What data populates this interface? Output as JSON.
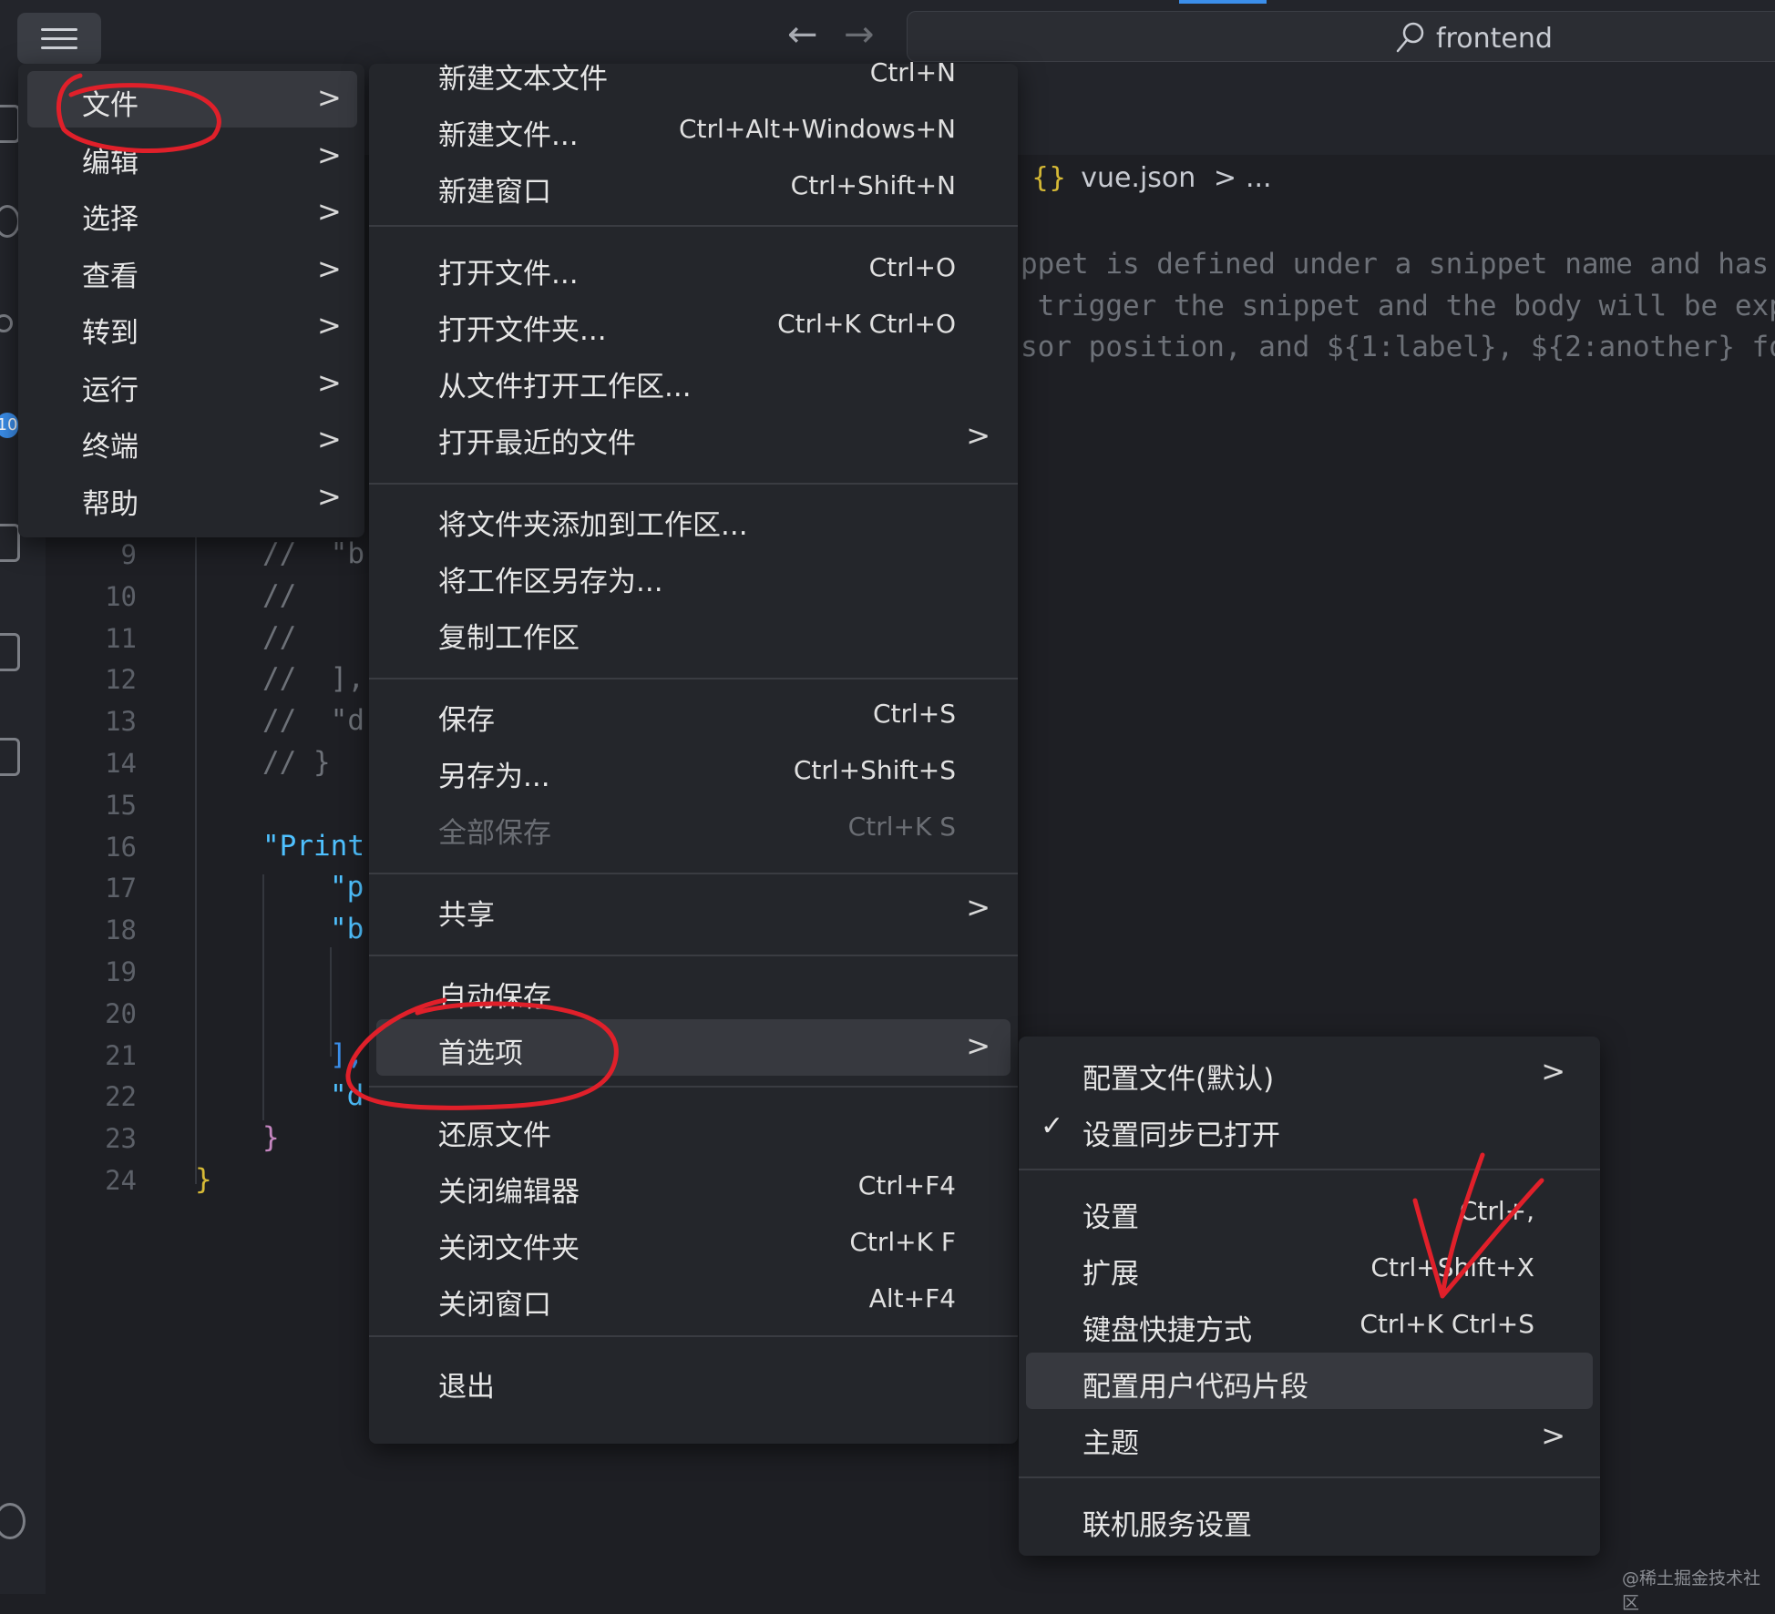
{
  "titlebar": {
    "search_text": "frontend",
    "back_glyph": "←",
    "forward_glyph": "→",
    "icons": [
      "menu-icon",
      "arrow-left-icon",
      "arrow-right-icon",
      "search-icon"
    ]
  },
  "activity_bar": {
    "badge": "10"
  },
  "breadcrumb": {
    "brace": "{}",
    "file": "vue.json",
    "sep": ">",
    "rest": "..."
  },
  "editor_comments": [
    "ppet is defined under a snippet name and has",
    " trigger the snippet and the body will be exp",
    "sor position, and ${1:label}, ${2:another} fo"
  ],
  "line_numbers": [
    "9",
    "10",
    "11",
    "12",
    "13",
    "14",
    "15",
    "16",
    "17",
    "18",
    "19",
    "20",
    "21",
    "22",
    "23",
    "24"
  ],
  "code_lines": [
    {
      "text": "//  \"b"
    },
    {
      "text": "//"
    },
    {
      "text": "//"
    },
    {
      "text": "//  ],"
    },
    {
      "text": "//  \"d"
    },
    {
      "text": "// }"
    },
    {
      "text": ""
    },
    {
      "text": "\"Print"
    },
    {
      "text": "\"p"
    },
    {
      "text": "\"b"
    },
    {
      "text": ""
    },
    {
      "text": ""
    },
    {
      "text": "],"
    },
    {
      "text": "\"d"
    },
    {
      "text": "}"
    },
    {
      "text": "}"
    }
  ],
  "main_menu": [
    {
      "label": "文件"
    },
    {
      "label": "编辑"
    },
    {
      "label": "选择"
    },
    {
      "label": "查看"
    },
    {
      "label": "转到"
    },
    {
      "label": "运行"
    },
    {
      "label": "终端"
    },
    {
      "label": "帮助"
    }
  ],
  "chevron": ">",
  "file_menu": [
    {
      "label": "新建文本文件",
      "shortcut": "Ctrl+N"
    },
    {
      "label": "新建文件...",
      "shortcut": "Ctrl+Alt+Windows+N"
    },
    {
      "label": "新建窗口",
      "shortcut": "Ctrl+Shift+N"
    },
    {
      "label": "打开文件...",
      "shortcut": "Ctrl+O"
    },
    {
      "label": "打开文件夹...",
      "shortcut": "Ctrl+K Ctrl+O"
    },
    {
      "label": "从文件打开工作区...",
      "shortcut": ""
    },
    {
      "label": "打开最近的文件",
      "shortcut": ""
    },
    {
      "label": "将文件夹添加到工作区...",
      "shortcut": ""
    },
    {
      "label": "将工作区另存为...",
      "shortcut": ""
    },
    {
      "label": "复制工作区",
      "shortcut": ""
    },
    {
      "label": "保存",
      "shortcut": "Ctrl+S"
    },
    {
      "label": "另存为...",
      "shortcut": "Ctrl+Shift+S"
    },
    {
      "label": "全部保存",
      "shortcut": "Ctrl+K S"
    },
    {
      "label": "共享",
      "shortcut": ""
    },
    {
      "label": "自动保存",
      "shortcut": ""
    },
    {
      "label": "首选项",
      "shortcut": ""
    },
    {
      "label": "还原文件",
      "shortcut": ""
    },
    {
      "label": "关闭编辑器",
      "shortcut": "Ctrl+F4"
    },
    {
      "label": "关闭文件夹",
      "shortcut": "Ctrl+K F"
    },
    {
      "label": "关闭窗口",
      "shortcut": "Alt+F4"
    },
    {
      "label": "退出",
      "shortcut": ""
    }
  ],
  "prefs_menu": [
    {
      "label": "配置文件(默认)",
      "shortcut": ""
    },
    {
      "label": "设置同步已打开",
      "shortcut": "",
      "check": "✓"
    },
    {
      "label": "设置",
      "shortcut": "Ctrl+,"
    },
    {
      "label": "扩展",
      "shortcut": "Ctrl+Shift+X"
    },
    {
      "label": "键盘快捷方式",
      "shortcut": "Ctrl+K Ctrl+S"
    },
    {
      "label": "配置用户代码片段",
      "shortcut": ""
    },
    {
      "label": "主题",
      "shortcut": ""
    },
    {
      "label": "联机服务设置",
      "shortcut": ""
    }
  ],
  "colors": {
    "accent": "#3b8eea",
    "annotation": "#e0202a",
    "menu_bg": "#24262b",
    "highlight": "#37393f"
  },
  "watermark": "@稀土掘金技术社区"
}
